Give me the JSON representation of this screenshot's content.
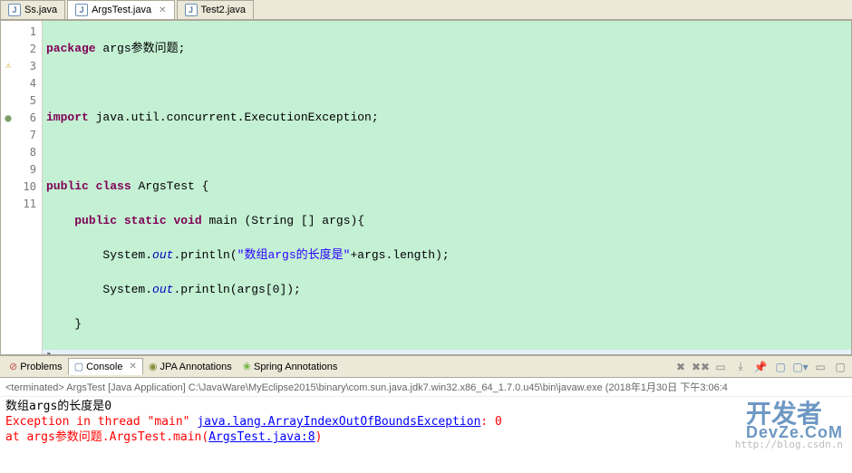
{
  "tabs": [
    {
      "label": "Ss.java",
      "active": false
    },
    {
      "label": "ArgsTest.java",
      "active": true
    },
    {
      "label": "Test2.java",
      "active": false
    }
  ],
  "gutter": {
    "warn_line": 3
  },
  "lines": {
    "l1": {
      "kw1": "package",
      "pkg": " args参数问题;"
    },
    "l3": {
      "kw1": "import",
      "rest": " java.util.concurrent.ExecutionException;"
    },
    "l5": {
      "kw1": "public",
      "kw2": "class",
      "name": " ArgsTest {"
    },
    "l6": {
      "indent": "    ",
      "kw1": "public",
      "kw2": "static",
      "kw3": "void",
      "sig": " main (String [] args){"
    },
    "l7": {
      "indent": "        System.",
      "field": "out",
      "mid": ".println(",
      "str": "\"数组args的长度是\"",
      "rest": "+args.length);"
    },
    "l8": {
      "indent": "        System.",
      "field": "out",
      "mid": ".println(args[0]);"
    },
    "l9": "    }",
    "l10": "}"
  },
  "console_tabs": {
    "problems": "Problems",
    "console": "Console",
    "jpa": "JPA Annotations",
    "spring": "Spring Annotations"
  },
  "console_status": "<terminated> ArgsTest [Java Application] C:\\JavaWare\\MyEclipse2015\\binary\\com.sun.java.jdk7.win32.x86_64_1.7.0.u45\\bin\\javaw.exe (2018年1月30日 下午3:06:4",
  "console": {
    "line1": "数组args的长度是0",
    "line2_pre": "Exception in thread \"main\" ",
    "line2_link": "java.lang.ArrayIndexOutOfBoundsException",
    "line2_post": ": 0",
    "line3_pre": "        at args参数问题.ArgsTest.main(",
    "line3_link": "ArgsTest.java:8",
    "line3_post": ")"
  },
  "watermark": "开发者",
  "watermark_brand": "DevZe.CoM",
  "watermark_sub": "http://blog.csdn.n"
}
